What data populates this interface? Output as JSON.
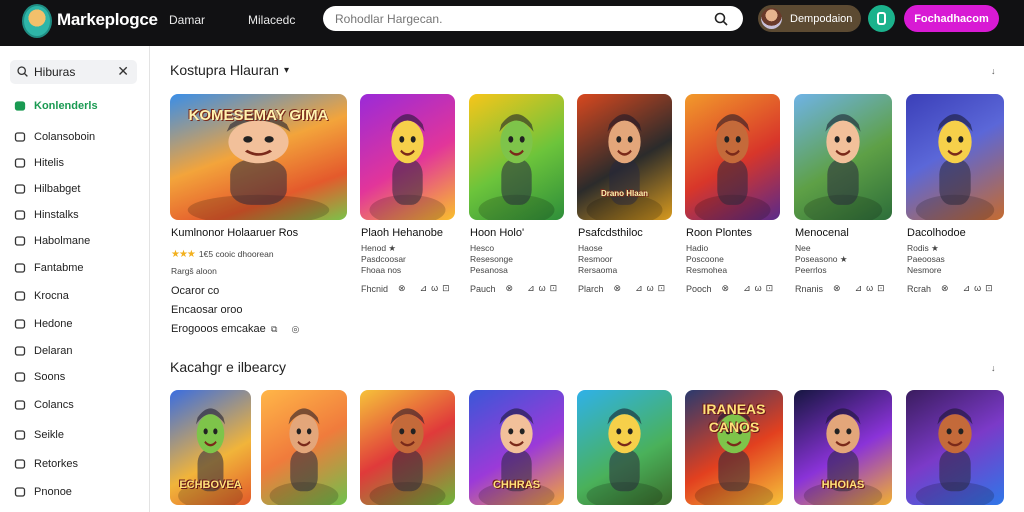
{
  "header": {
    "brand": "Markeplogce",
    "nav": [
      "Damar",
      "Milacedc"
    ],
    "search_placeholder": "Rohodlar Hargecan.",
    "user_name": "Dempodaion",
    "cta_label": "Fochadhacom",
    "accent": "#d81ad4"
  },
  "sidebar": {
    "search_value": "Hiburas",
    "items": [
      {
        "label": "Konlenderls",
        "icon": "store-icon",
        "active": true
      },
      {
        "label": "Colansoboin",
        "icon": "chat-icon"
      },
      {
        "label": "Hitelis",
        "icon": "gamepad-icon"
      },
      {
        "label": "Hilbabget",
        "icon": "box-icon"
      },
      {
        "label": "Hinstalks",
        "icon": "heart-icon"
      },
      {
        "label": "Habolmane",
        "icon": "square-icon"
      },
      {
        "label": "Fantabme",
        "icon": "list-icon"
      },
      {
        "label": "Krocna",
        "icon": "pencil-icon"
      },
      {
        "label": "Hedone",
        "icon": "briefcase-icon"
      },
      {
        "label": "Delaran",
        "icon": "clock-icon"
      },
      {
        "label": "Soons",
        "icon": "search-icon"
      },
      {
        "label": "Colancs",
        "icon": "image-icon"
      },
      {
        "label": "Seikle",
        "icon": "tool-icon"
      },
      {
        "label": "Retorkes",
        "icon": "flag-icon"
      },
      {
        "label": "Pnonoe",
        "icon": "user-icon"
      }
    ]
  },
  "section1": {
    "title": "Kostupra Hlauran",
    "sort": "↓",
    "cards": [
      {
        "title": "Kumlnonor Holaaruer Ros",
        "rating": "★★★",
        "rating_text": "1€5 cooic dhoorean",
        "line2": "Rargš aloon",
        "extra1": "Ocaror co",
        "extra2": "Encaosar oroo",
        "extra3": "Erogooos emcakae",
        "logo_text": "KOMESEMAY GIMA"
      },
      {
        "title": "Plaoh Hehanobe",
        "rating_text": "Henod ★",
        "line2": "Pasdcoosar",
        "line3": "Fhoaa nos",
        "foot": "Fhcnid"
      },
      {
        "title": "Hoon Holo'",
        "rating_text": "Hesco",
        "line2": "Resesonge",
        "line3": "Pesanosa",
        "foot": "Pauch"
      },
      {
        "title": "Psafcdsthiloc",
        "rating_text": "Haose",
        "line2": "Resmoor",
        "line3": "Rersaoma",
        "foot": "Plarch",
        "logo_text": "Drano Hlaan"
      },
      {
        "title": "Roon Plontes",
        "rating_text": "Hadio",
        "line2": "Poscoone",
        "line3": "Resmohea",
        "foot": "Pooch"
      },
      {
        "title": "Menocenal",
        "rating_text": "Nee",
        "line2": "Poseasono ★",
        "line3": "Peerrlos",
        "foot": "Rnanis"
      },
      {
        "title": "Dacolhodoe",
        "rating_text": "Rodis ★",
        "line2": "Paeoosas",
        "line3": "Nesmore",
        "foot": "Rcrah"
      }
    ]
  },
  "section2": {
    "title": "Kacahgr e ilbearcy",
    "sort": "↓",
    "cards": [
      {
        "logo_text": "ECHBOVEA"
      },
      {},
      {},
      {
        "logo_text": "CHHRAS"
      },
      {},
      {
        "logo_text": "IRANEAS CANOS"
      },
      {
        "logo_text": "HHOIAS"
      },
      {}
    ]
  }
}
